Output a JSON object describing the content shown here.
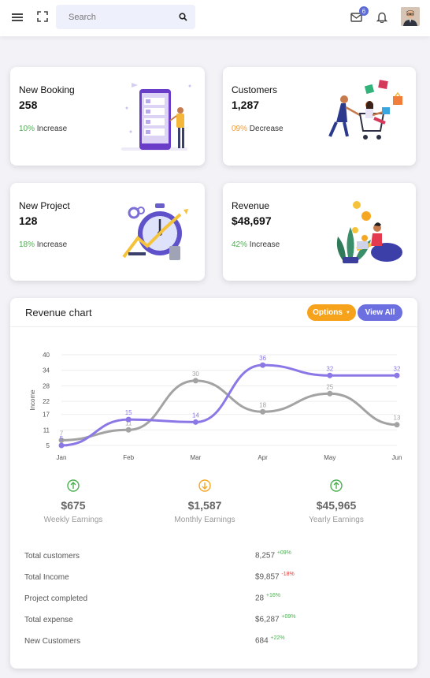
{
  "search": {
    "placeholder": "Search"
  },
  "notifications": {
    "mail_count": "6"
  },
  "cards": [
    {
      "title": "New Booking",
      "value": "258",
      "pct": "10%",
      "trend": "Increase",
      "dir": "up"
    },
    {
      "title": "Customers",
      "value": "1,287",
      "pct": "09%",
      "trend": "Decrease",
      "dir": "down"
    },
    {
      "title": "New Project",
      "value": "128",
      "pct": "18%",
      "trend": "Increase",
      "dir": "up"
    },
    {
      "title": "Revenue",
      "value": "$48,697",
      "pct": "42%",
      "trend": "Increase",
      "dir": "up"
    }
  ],
  "revenue": {
    "title": "Revenue chart",
    "options_label": "Options",
    "viewall_label": "View All",
    "colors": {
      "options": "#f7a21b",
      "viewall": "#6c6fe0",
      "series_a": "#8b78e6",
      "series_b": "#a3a3a3"
    }
  },
  "chart_data": {
    "type": "line",
    "x": [
      "Jan",
      "Feb",
      "Mar",
      "Apr",
      "May",
      "Jun"
    ],
    "ylabel": "Income",
    "yticks": [
      5,
      11,
      17,
      22,
      28,
      34,
      40
    ],
    "ylim": [
      5,
      40
    ],
    "series": [
      {
        "values": [
          5,
          15,
          14,
          36,
          32,
          32
        ],
        "color": "#8b78e6"
      },
      {
        "values": [
          7,
          11,
          30,
          18,
          25,
          13
        ],
        "color": "#a3a3a3"
      }
    ],
    "grid": true
  },
  "earnings": [
    {
      "amount": "$675",
      "label": "Weekly Earnings",
      "dir": "up"
    },
    {
      "amount": "$1,587",
      "label": "Monthly Earnings",
      "dir": "down"
    },
    {
      "amount": "$45,965",
      "label": "Yearly Earnings",
      "dir": "up"
    }
  ],
  "stats": [
    {
      "label": "Total customers",
      "value": "8,257",
      "change": "+09%",
      "dir": "up"
    },
    {
      "label": "Total Income",
      "value": "$9,857",
      "change": "-18%",
      "dir": "down"
    },
    {
      "label": "Project completed",
      "value": "28",
      "change": "+16%",
      "dir": "up"
    },
    {
      "label": "Total expense",
      "value": "$6,287",
      "change": "+09%",
      "dir": "up"
    },
    {
      "label": "New Customers",
      "value": "684",
      "change": "+22%",
      "dir": "up"
    }
  ]
}
